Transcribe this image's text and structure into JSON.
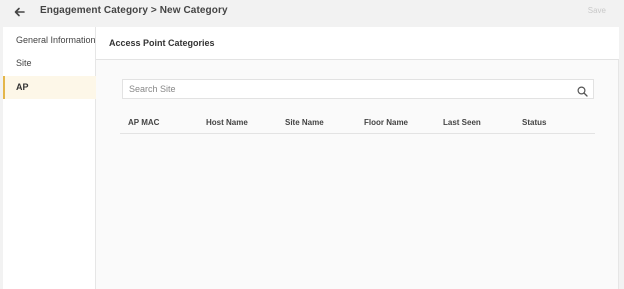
{
  "header": {
    "back_icon": "arrow-left-icon",
    "breadcrumb": "Engagement Category > New Category",
    "save_label": "Save"
  },
  "sidebar": {
    "items": [
      {
        "label": "General Information",
        "active": false
      },
      {
        "label": "Site",
        "active": false
      },
      {
        "label": "AP",
        "active": true
      }
    ]
  },
  "main": {
    "title": "Access Point Categories",
    "search": {
      "placeholder": "Search Site",
      "value": "",
      "icon": "search-icon"
    },
    "table": {
      "columns": [
        "AP MAC",
        "Host Name",
        "Site Name",
        "Floor Name",
        "Last Seen",
        "Status"
      ],
      "rows": []
    }
  },
  "colors": {
    "accent": "#e4b64a",
    "active_bg": "#fdf7e8",
    "disabled_text": "#c9c9c9"
  }
}
